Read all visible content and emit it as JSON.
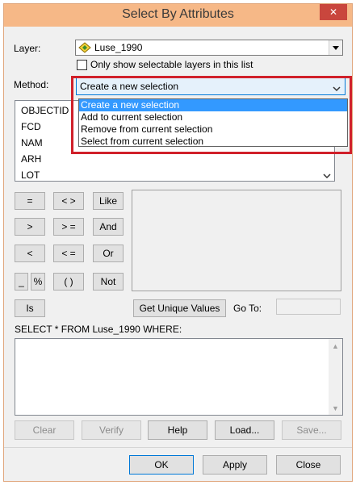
{
  "window": {
    "title": "Select By Attributes",
    "close_glyph": "✕"
  },
  "layer": {
    "label": "Layer:",
    "value": "Luse_1990",
    "only_selectable_label": "Only show selectable layers in this list"
  },
  "method": {
    "label": "Method:",
    "value": "Create a new selection",
    "options": [
      "Create a new selection",
      "Add to current selection",
      "Remove from current selection",
      "Select from current selection"
    ]
  },
  "fields": [
    "OBJECTID",
    "FCD",
    "NAM",
    "ARH",
    "LOT"
  ],
  "operators": {
    "eq": "=",
    "ne": "< >",
    "like": "Like",
    "gt": ">",
    "ge": "> =",
    "and": "And",
    "lt": "<",
    "le": "< =",
    "or": "Or",
    "underscore": "_",
    "percent": "%",
    "parens": "( )",
    "not": "Not",
    "is": "Is"
  },
  "unique": {
    "button": "Get Unique Values",
    "goto_label": "Go To:",
    "goto_value": ""
  },
  "query": {
    "label": "SELECT * FROM Luse_1990 WHERE:",
    "value": ""
  },
  "actions": {
    "clear": "Clear",
    "verify": "Verify",
    "help": "Help",
    "load": "Load...",
    "save": "Save..."
  },
  "footer": {
    "ok": "OK",
    "apply": "Apply",
    "close": "Close"
  },
  "colors": {
    "titlebar": "#f6b887",
    "close": "#c9463d",
    "selection": "#3399ff",
    "highlight_box": "#d0202a"
  }
}
